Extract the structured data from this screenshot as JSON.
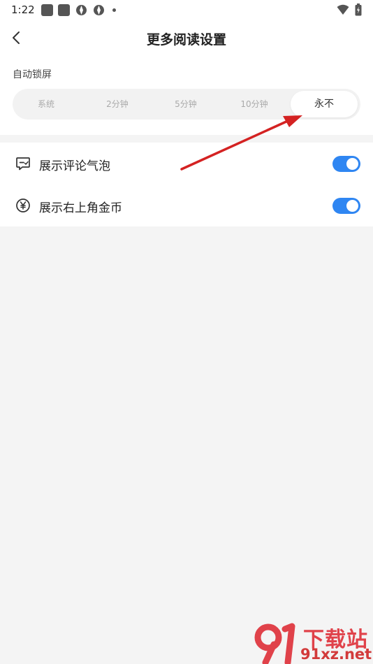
{
  "status_bar": {
    "time": "1:22"
  },
  "header": {
    "title": "更多阅读设置",
    "back_icon": "chevron-left-icon"
  },
  "auto_lock": {
    "label": "自动锁屏",
    "options": [
      "系统",
      "2分钟",
      "5分钟",
      "10分钟",
      "永不"
    ],
    "selected": "永不"
  },
  "settings": [
    {
      "icon": "comment-bubble-icon",
      "label": "展示评论气泡",
      "enabled": true
    },
    {
      "icon": "yen-coin-icon",
      "label": "展示右上角金币",
      "enabled": true
    }
  ],
  "watermark": {
    "title": "下载站",
    "url": "91xz.net"
  },
  "colors": {
    "toggle_on": "#2f86f2",
    "annotation_arrow": "#d42222",
    "background": "#f4f4f4"
  }
}
